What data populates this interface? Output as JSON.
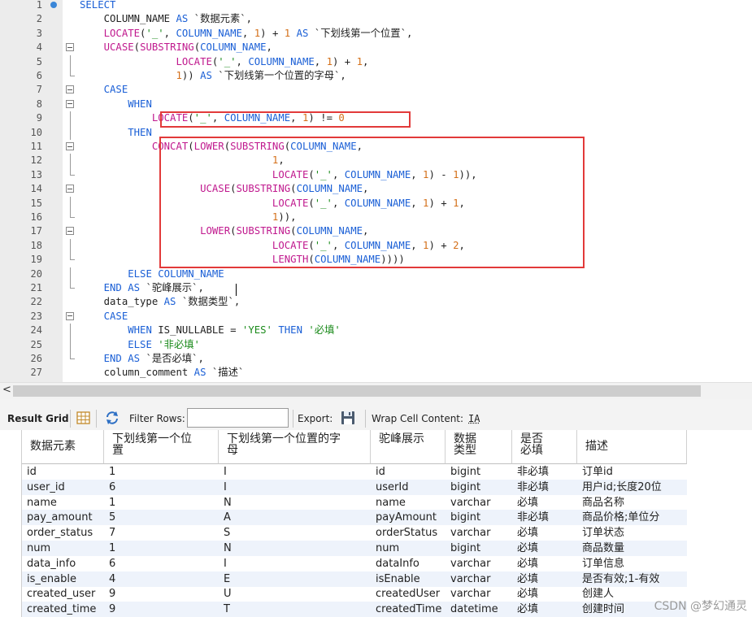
{
  "editor": {
    "lines": [
      {
        "n": "1",
        "tokens": [
          [
            "kw",
            "SELECT"
          ]
        ]
      },
      {
        "n": "2",
        "tokens": [
          [
            "op",
            "    "
          ],
          [
            "op",
            "COLUMN_NAME "
          ],
          [
            "kw",
            "AS"
          ],
          [
            "bt",
            " `数据元素`,"
          ]
        ]
      },
      {
        "n": "3",
        "tokens": [
          [
            "op",
            "    "
          ],
          [
            "fn",
            "LOCATE"
          ],
          [
            "op",
            "("
          ],
          [
            "str",
            "'_'"
          ],
          [
            "op",
            ", "
          ],
          [
            "fld",
            "COLUMN_NAME"
          ],
          [
            "op",
            ", "
          ],
          [
            "num",
            "1"
          ],
          [
            "op",
            ") + "
          ],
          [
            "num",
            "1"
          ],
          [
            "op",
            " "
          ],
          [
            "kw",
            "AS"
          ],
          [
            "bt",
            " `下划线第一个位置`,"
          ]
        ]
      },
      {
        "n": "4",
        "tokens": [
          [
            "op",
            "    "
          ],
          [
            "fn",
            "UCASE"
          ],
          [
            "op",
            "("
          ],
          [
            "fn",
            "SUBSTRING"
          ],
          [
            "op",
            "("
          ],
          [
            "fld",
            "COLUMN_NAME"
          ],
          [
            "op",
            ","
          ]
        ]
      },
      {
        "n": "5",
        "tokens": [
          [
            "op",
            "                "
          ],
          [
            "fn",
            "LOCATE"
          ],
          [
            "op",
            "("
          ],
          [
            "str",
            "'_'"
          ],
          [
            "op",
            ", "
          ],
          [
            "fld",
            "COLUMN_NAME"
          ],
          [
            "op",
            ", "
          ],
          [
            "num",
            "1"
          ],
          [
            "op",
            ") + "
          ],
          [
            "num",
            "1"
          ],
          [
            "op",
            ","
          ]
        ]
      },
      {
        "n": "6",
        "tokens": [
          [
            "op",
            "                "
          ],
          [
            "num",
            "1"
          ],
          [
            "op",
            ")) "
          ],
          [
            "kw",
            "AS"
          ],
          [
            "bt",
            " `下划线第一个位置的字母`,"
          ]
        ]
      },
      {
        "n": "7",
        "tokens": [
          [
            "op",
            "    "
          ],
          [
            "kw",
            "CASE"
          ]
        ]
      },
      {
        "n": "8",
        "tokens": [
          [
            "op",
            "        "
          ],
          [
            "kw",
            "WHEN"
          ]
        ]
      },
      {
        "n": "9",
        "tokens": [
          [
            "op",
            "            "
          ],
          [
            "fn",
            "LOCATE"
          ],
          [
            "op",
            "("
          ],
          [
            "str",
            "'_'"
          ],
          [
            "op",
            ", "
          ],
          [
            "fld",
            "COLUMN_NAME"
          ],
          [
            "op",
            ", "
          ],
          [
            "num",
            "1"
          ],
          [
            "op",
            ") != "
          ],
          [
            "num",
            "0"
          ]
        ]
      },
      {
        "n": "10",
        "tokens": [
          [
            "op",
            "        "
          ],
          [
            "kw",
            "THEN"
          ]
        ]
      },
      {
        "n": "11",
        "tokens": [
          [
            "op",
            "            "
          ],
          [
            "fn",
            "CONCAT"
          ],
          [
            "op",
            "("
          ],
          [
            "fn",
            "LOWER"
          ],
          [
            "op",
            "("
          ],
          [
            "fn",
            "SUBSTRING"
          ],
          [
            "op",
            "("
          ],
          [
            "fld",
            "COLUMN_NAME"
          ],
          [
            "op",
            ","
          ]
        ]
      },
      {
        "n": "12",
        "tokens": [
          [
            "op",
            "                                "
          ],
          [
            "num",
            "1"
          ],
          [
            "op",
            ","
          ]
        ]
      },
      {
        "n": "13",
        "tokens": [
          [
            "op",
            "                                "
          ],
          [
            "fn",
            "LOCATE"
          ],
          [
            "op",
            "("
          ],
          [
            "str",
            "'_'"
          ],
          [
            "op",
            ", "
          ],
          [
            "fld",
            "COLUMN_NAME"
          ],
          [
            "op",
            ", "
          ],
          [
            "num",
            "1"
          ],
          [
            "op",
            ") - "
          ],
          [
            "num",
            "1"
          ],
          [
            "op",
            ")),"
          ]
        ]
      },
      {
        "n": "14",
        "tokens": [
          [
            "op",
            "                    "
          ],
          [
            "fn",
            "UCASE"
          ],
          [
            "op",
            "("
          ],
          [
            "fn",
            "SUBSTRING"
          ],
          [
            "op",
            "("
          ],
          [
            "fld",
            "COLUMN_NAME"
          ],
          [
            "op",
            ","
          ]
        ]
      },
      {
        "n": "15",
        "tokens": [
          [
            "op",
            "                                "
          ],
          [
            "fn",
            "LOCATE"
          ],
          [
            "op",
            "("
          ],
          [
            "str",
            "'_'"
          ],
          [
            "op",
            ", "
          ],
          [
            "fld",
            "COLUMN_NAME"
          ],
          [
            "op",
            ", "
          ],
          [
            "num",
            "1"
          ],
          [
            "op",
            ") + "
          ],
          [
            "num",
            "1"
          ],
          [
            "op",
            ","
          ]
        ]
      },
      {
        "n": "16",
        "tokens": [
          [
            "op",
            "                                "
          ],
          [
            "num",
            "1"
          ],
          [
            "op",
            ")),"
          ]
        ]
      },
      {
        "n": "17",
        "tokens": [
          [
            "op",
            "                    "
          ],
          [
            "fn",
            "LOWER"
          ],
          [
            "op",
            "("
          ],
          [
            "fn",
            "SUBSTRING"
          ],
          [
            "op",
            "("
          ],
          [
            "fld",
            "COLUMN_NAME"
          ],
          [
            "op",
            ","
          ]
        ]
      },
      {
        "n": "18",
        "tokens": [
          [
            "op",
            "                                "
          ],
          [
            "fn",
            "LOCATE"
          ],
          [
            "op",
            "("
          ],
          [
            "str",
            "'_'"
          ],
          [
            "op",
            ", "
          ],
          [
            "fld",
            "COLUMN_NAME"
          ],
          [
            "op",
            ", "
          ],
          [
            "num",
            "1"
          ],
          [
            "op",
            ") + "
          ],
          [
            "num",
            "2"
          ],
          [
            "op",
            ","
          ]
        ]
      },
      {
        "n": "19",
        "tokens": [
          [
            "op",
            "                                "
          ],
          [
            "fn",
            "LENGTH"
          ],
          [
            "op",
            "("
          ],
          [
            "fld",
            "COLUMN_NAME"
          ],
          [
            "op",
            "))))"
          ]
        ]
      },
      {
        "n": "20",
        "tokens": [
          [
            "op",
            "        "
          ],
          [
            "kw",
            "ELSE"
          ],
          [
            "op",
            " "
          ],
          [
            "fld",
            "COLUMN_NAME"
          ]
        ]
      },
      {
        "n": "21",
        "tokens": [
          [
            "op",
            "    "
          ],
          [
            "kw",
            "END"
          ],
          [
            "op",
            " "
          ],
          [
            "kw",
            "AS"
          ],
          [
            "bt",
            " `驼峰展示`,"
          ]
        ]
      },
      {
        "n": "22",
        "tokens": [
          [
            "op",
            "    data_type "
          ],
          [
            "kw",
            "AS"
          ],
          [
            "bt",
            " `数据类型`,"
          ]
        ]
      },
      {
        "n": "23",
        "tokens": [
          [
            "op",
            "    "
          ],
          [
            "kw",
            "CASE"
          ]
        ]
      },
      {
        "n": "24",
        "tokens": [
          [
            "op",
            "        "
          ],
          [
            "kw",
            "WHEN"
          ],
          [
            "op",
            " IS_NULLABLE = "
          ],
          [
            "str",
            "'YES'"
          ],
          [
            "op",
            " "
          ],
          [
            "kw",
            "THEN"
          ],
          [
            "op",
            " "
          ],
          [
            "str",
            "'必填'"
          ]
        ]
      },
      {
        "n": "25",
        "tokens": [
          [
            "op",
            "        "
          ],
          [
            "kw",
            "ELSE"
          ],
          [
            "op",
            " "
          ],
          [
            "str",
            "'非必填'"
          ]
        ]
      },
      {
        "n": "26",
        "tokens": [
          [
            "op",
            "    "
          ],
          [
            "kw",
            "END"
          ],
          [
            "op",
            " "
          ],
          [
            "kw",
            "AS"
          ],
          [
            "bt",
            " `是否必填`,"
          ]
        ]
      },
      {
        "n": "27",
        "tokens": [
          [
            "op",
            "    column_comment "
          ],
          [
            "kw",
            "AS"
          ],
          [
            "bt",
            " `描述`"
          ]
        ]
      }
    ]
  },
  "scrollbar": {
    "left_arrow": "<"
  },
  "toolbar": {
    "result_grid": "Result Grid",
    "filter_rows": "Filter Rows:",
    "filter_value": "",
    "export": "Export:",
    "wrap_cell": "Wrap Cell Content:",
    "wrap_icon_text": "IA"
  },
  "grid": {
    "columns": [
      "数据元素",
      "下划线第一个位置",
      "下划线第一个位置的字母",
      "驼峰展示",
      "数据类型",
      "是否必填",
      "描述"
    ],
    "rows": [
      [
        "id",
        "1",
        "I",
        "id",
        "bigint",
        "非必填",
        "订单id"
      ],
      [
        "user_id",
        "6",
        "I",
        "userId",
        "bigint",
        "非必填",
        "用户id;长度20位"
      ],
      [
        "name",
        "1",
        "N",
        "name",
        "varchar",
        "必填",
        "商品名称"
      ],
      [
        "pay_amount",
        "5",
        "A",
        "payAmount",
        "bigint",
        "非必填",
        "商品价格;单位分"
      ],
      [
        "order_status",
        "7",
        "S",
        "orderStatus",
        "varchar",
        "必填",
        "订单状态"
      ],
      [
        "num",
        "1",
        "N",
        "num",
        "bigint",
        "必填",
        "商品数量"
      ],
      [
        "data_info",
        "6",
        "I",
        "dataInfo",
        "varchar",
        "必填",
        "订单信息"
      ],
      [
        "is_enable",
        "4",
        "E",
        "isEnable",
        "varchar",
        "必填",
        "是否有效;1-有效"
      ],
      [
        "created_user",
        "9",
        "U",
        "createdUser",
        "varchar",
        "必填",
        "创建人"
      ],
      [
        "created_time",
        "9",
        "T",
        "createdTime",
        "datetime",
        "必填",
        "创建时间"
      ]
    ]
  },
  "watermark": "CSDN @梦幻通灵"
}
